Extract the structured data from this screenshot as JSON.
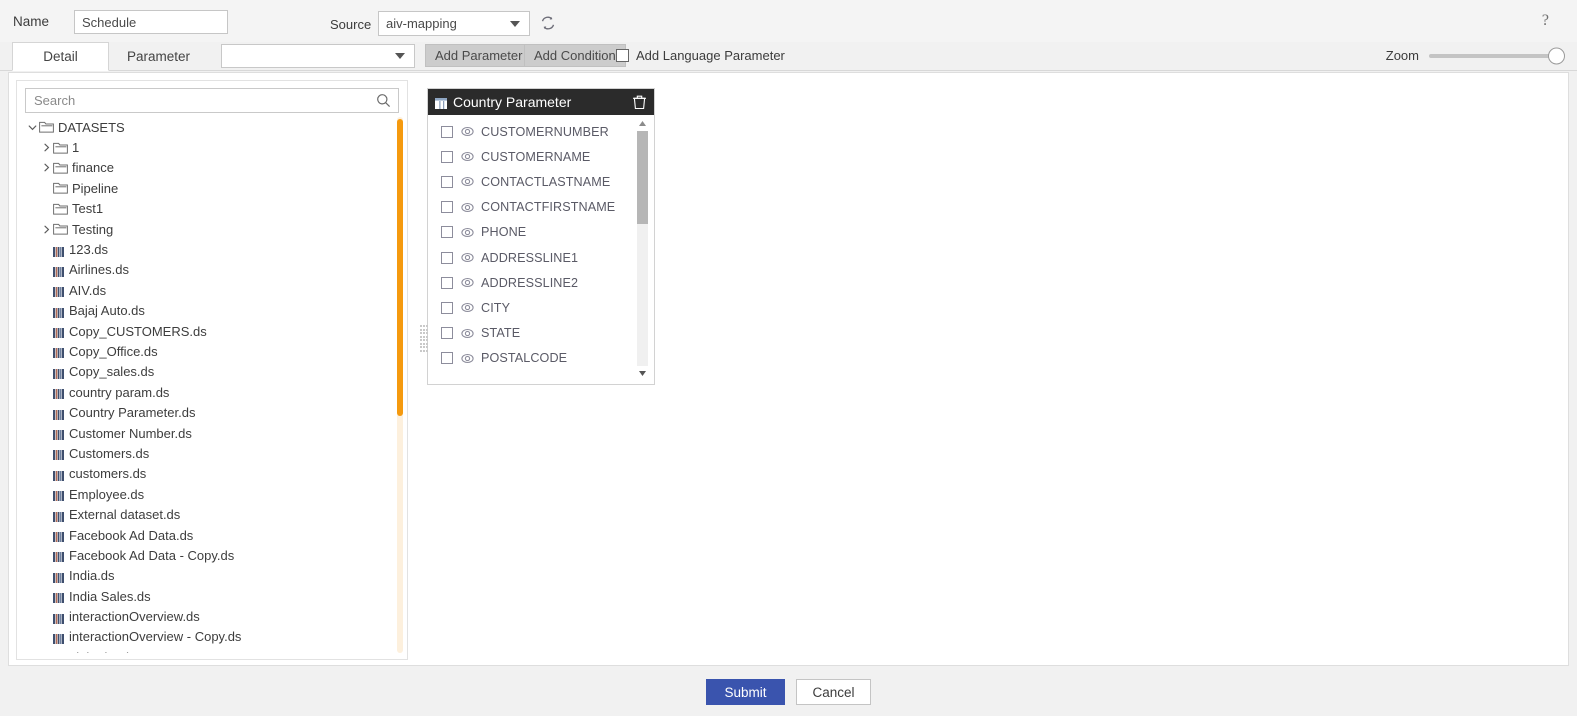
{
  "header": {
    "name_label": "Name",
    "name_value": "Schedule",
    "source_label": "Source",
    "source_value": "aiv-mapping",
    "refresh_icon": "refresh-icon",
    "help_icon": "help-icon",
    "help_glyph": "?"
  },
  "tabs": [
    {
      "label": "Detail",
      "active": true
    },
    {
      "label": "Parameter",
      "active": false
    }
  ],
  "toolbar": {
    "param_select_value": "",
    "add_parameter_label": "Add Parameter",
    "add_condition_label": "Add Condition",
    "add_language_parameter_label": "Add Language Parameter",
    "add_language_parameter_checked": false,
    "zoom_label": "Zoom",
    "zoom_value": 100
  },
  "tree_panel": {
    "search_placeholder": "Search",
    "search_value": "",
    "search_icon": "search-icon",
    "scrollbar_color": "#f59a0f",
    "items": [
      {
        "label": "DATASETS",
        "type": "folder",
        "indent": 0,
        "arrow": "down"
      },
      {
        "label": "1",
        "type": "folder",
        "indent": 1,
        "arrow": "right"
      },
      {
        "label": "finance",
        "type": "folder",
        "indent": 1,
        "arrow": "right"
      },
      {
        "label": "Pipeline",
        "type": "folder",
        "indent": 1,
        "arrow": "none"
      },
      {
        "label": "Test1",
        "type": "folder",
        "indent": 1,
        "arrow": "none"
      },
      {
        "label": "Testing",
        "type": "folder",
        "indent": 1,
        "arrow": "right"
      },
      {
        "label": "123.ds",
        "type": "dataset",
        "indent": 1,
        "arrow": "none"
      },
      {
        "label": "Airlines.ds",
        "type": "dataset",
        "indent": 1,
        "arrow": "none"
      },
      {
        "label": "AIV.ds",
        "type": "dataset",
        "indent": 1,
        "arrow": "none"
      },
      {
        "label": "Bajaj Auto.ds",
        "type": "dataset",
        "indent": 1,
        "arrow": "none"
      },
      {
        "label": "Copy_CUSTOMERS.ds",
        "type": "dataset",
        "indent": 1,
        "arrow": "none"
      },
      {
        "label": "Copy_Office.ds",
        "type": "dataset",
        "indent": 1,
        "arrow": "none"
      },
      {
        "label": "Copy_sales.ds",
        "type": "dataset",
        "indent": 1,
        "arrow": "none"
      },
      {
        "label": "country param.ds",
        "type": "dataset",
        "indent": 1,
        "arrow": "none"
      },
      {
        "label": "Country Parameter.ds",
        "type": "dataset",
        "indent": 1,
        "arrow": "none"
      },
      {
        "label": "Customer Number.ds",
        "type": "dataset",
        "indent": 1,
        "arrow": "none"
      },
      {
        "label": "Customers.ds",
        "type": "dataset",
        "indent": 1,
        "arrow": "none"
      },
      {
        "label": "customers.ds",
        "type": "dataset",
        "indent": 1,
        "arrow": "none"
      },
      {
        "label": "Employee.ds",
        "type": "dataset",
        "indent": 1,
        "arrow": "none"
      },
      {
        "label": "External dataset.ds",
        "type": "dataset",
        "indent": 1,
        "arrow": "none"
      },
      {
        "label": "Facebook Ad Data.ds",
        "type": "dataset",
        "indent": 1,
        "arrow": "none"
      },
      {
        "label": "Facebook Ad Data - Copy.ds",
        "type": "dataset",
        "indent": 1,
        "arrow": "none"
      },
      {
        "label": "India.ds",
        "type": "dataset",
        "indent": 1,
        "arrow": "none"
      },
      {
        "label": "India Sales.ds",
        "type": "dataset",
        "indent": 1,
        "arrow": "none"
      },
      {
        "label": "interactionOverview.ds",
        "type": "dataset",
        "indent": 1,
        "arrow": "none"
      },
      {
        "label": "interactionOverview - Copy.ds",
        "type": "dataset",
        "indent": 1,
        "arrow": "none"
      },
      {
        "label": "LinkedIn.ds",
        "type": "dataset",
        "indent": 1,
        "arrow": "none"
      }
    ]
  },
  "parameter_widget": {
    "title": "Country Parameter",
    "title_icon": "dataset-icon",
    "delete_icon": "trash-icon",
    "fields": [
      {
        "name": "CUSTOMERNUMBER",
        "checked": false
      },
      {
        "name": "CUSTOMERNAME",
        "checked": false
      },
      {
        "name": "CONTACTLASTNAME",
        "checked": false
      },
      {
        "name": "CONTACTFIRSTNAME",
        "checked": false
      },
      {
        "name": "PHONE",
        "checked": false
      },
      {
        "name": "ADDRESSLINE1",
        "checked": false
      },
      {
        "name": "ADDRESSLINE2",
        "checked": false
      },
      {
        "name": "CITY",
        "checked": false
      },
      {
        "name": "STATE",
        "checked": false
      },
      {
        "name": "POSTALCODE",
        "checked": false
      }
    ]
  },
  "footer": {
    "submit_label": "Submit",
    "cancel_label": "Cancel",
    "submit_color": "#3a54ae"
  }
}
